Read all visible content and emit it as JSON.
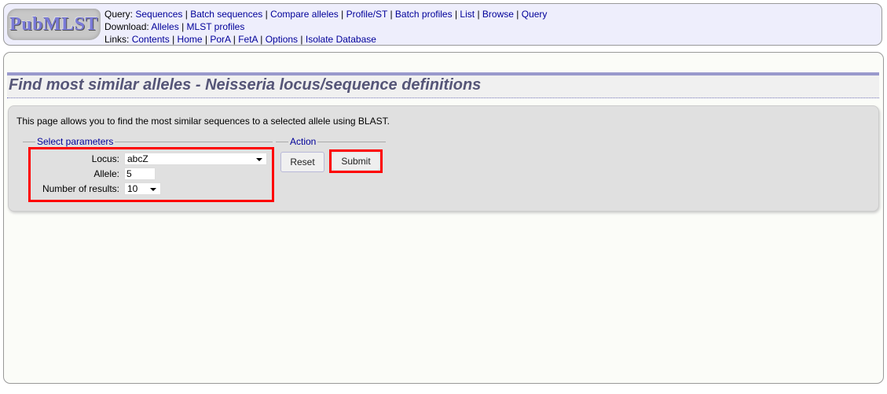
{
  "header": {
    "logo_text": "PubMLST",
    "query": {
      "label": "Query:",
      "links": [
        "Sequences",
        "Batch sequences",
        "Compare alleles",
        "Profile/ST",
        "Batch profiles",
        "List",
        "Browse",
        "Query"
      ]
    },
    "download": {
      "label": "Download:",
      "links": [
        "Alleles",
        "MLST profiles"
      ]
    },
    "links": {
      "label": "Links:",
      "links": [
        "Contents",
        "Home",
        "PorA",
        "FetA",
        "Options",
        "Isolate Database"
      ]
    }
  },
  "page": {
    "title": "Find most similar alleles - Neisseria locus/sequence definitions",
    "intro": "This page allows you to find the most similar sequences to a selected allele using BLAST."
  },
  "params": {
    "legend": "Select parameters",
    "locus_label": "Locus:",
    "locus_value": "abcZ",
    "allele_label": "Allele:",
    "allele_value": "5",
    "results_label": "Number of results:",
    "results_value": "10"
  },
  "action": {
    "legend": "Action",
    "reset_label": "Reset",
    "submit_label": "Submit"
  },
  "colors": {
    "link": "#000099",
    "highlight": "#ff0000",
    "title": "#555577"
  }
}
